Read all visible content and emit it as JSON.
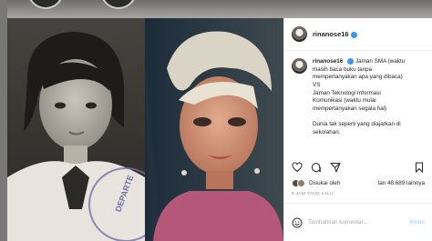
{
  "post": {
    "username": "rinanose16",
    "caption_username": "rinanose16",
    "caption_lines": [
      "Jaman SMA (waktu",
      "masih baca buku tanpa",
      "mempertanyakan apa yang dibaca)",
      "VS",
      "Jaman Teknologi Informasi",
      "Komunikasi (waktu mulai",
      "mempertanyakan segala hal)",
      "",
      "Dunia tak seperti yang diajarkan di",
      "sekolahan."
    ],
    "likes_prefix": "Disukai oleh",
    "likes_count": "Ian 48.689 lainnya",
    "time_ago": "5 JAM YANG LALU",
    "comment_placeholder": "Tambahkan komentar...",
    "comment_submit": "Kirim",
    "photo_stamp": "DEPARTE"
  },
  "colors": {
    "verified": "#3897f0",
    "muted": "#8e8e8e",
    "text": "#262626"
  },
  "icons": [
    "heart-icon",
    "comment-icon",
    "share-icon",
    "bookmark-icon",
    "smiley-icon"
  ]
}
